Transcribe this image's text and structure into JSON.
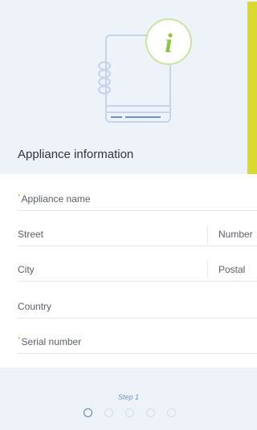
{
  "section_title": "Appliance information",
  "icon_letter": "i",
  "fields": {
    "appliance_name": {
      "required_mark": "*",
      "label": "Appliance name"
    },
    "street": {
      "label": "Street"
    },
    "number": {
      "label": "Number"
    },
    "city": {
      "label": "City"
    },
    "postal": {
      "label": "Postal"
    },
    "country": {
      "label": "Country"
    },
    "serial_number": {
      "required_mark": "*",
      "label": "Serial number"
    }
  },
  "step": {
    "label": "Step 1",
    "current": 1,
    "total": 5
  },
  "colors": {
    "accent_yellow": "#d8da31",
    "icon_green": "#8cc63f",
    "step_blue": "#5b7fbf"
  }
}
